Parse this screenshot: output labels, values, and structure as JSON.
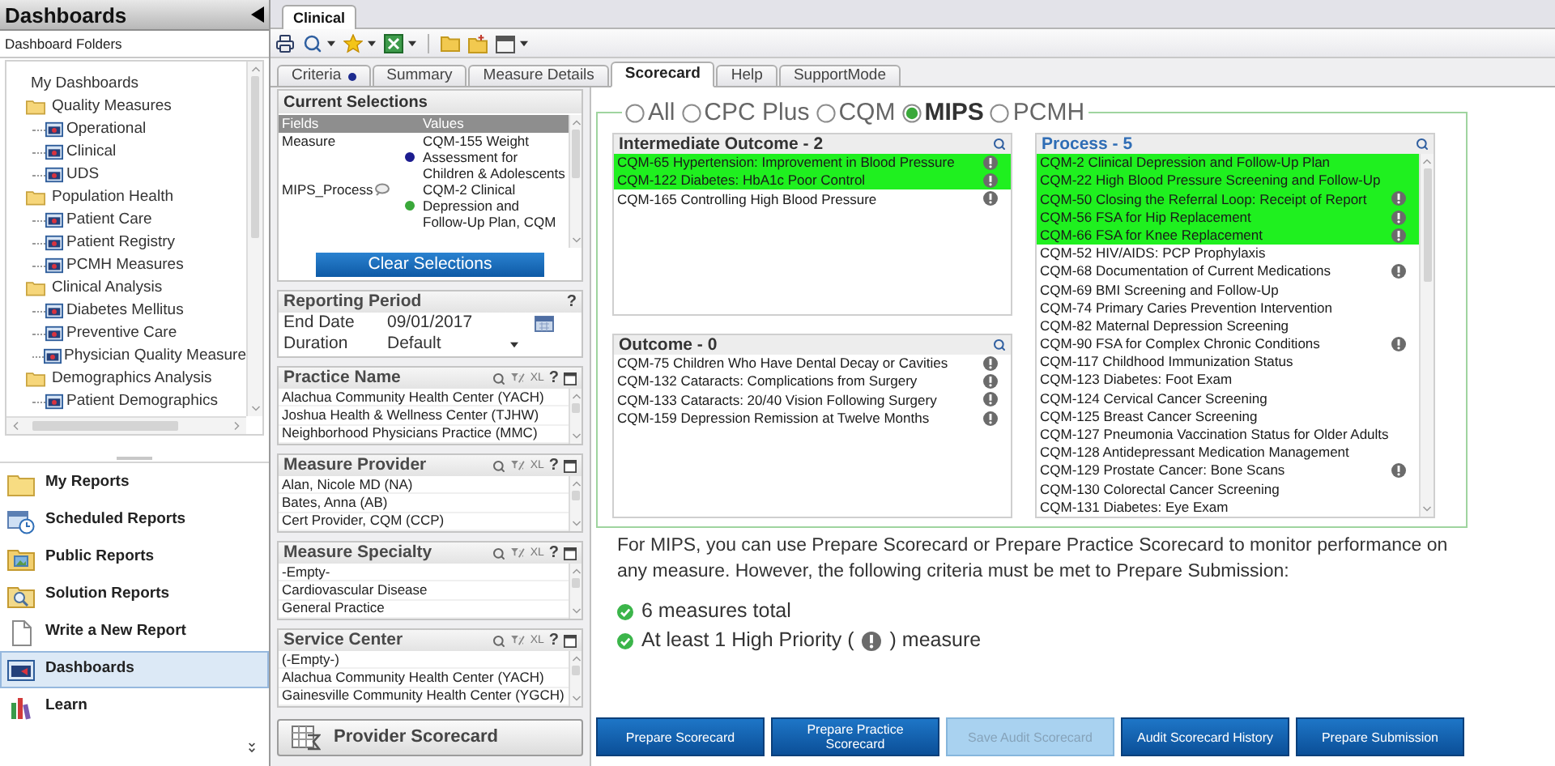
{
  "sidebar": {
    "title": "Dashboards",
    "subtitle": "Dashboard Folders",
    "tree": [
      {
        "label": "My Dashboards",
        "children": [
          {
            "label": "Quality Measures",
            "children": [
              {
                "label": "Operational"
              },
              {
                "label": "Clinical"
              },
              {
                "label": "UDS"
              }
            ]
          },
          {
            "label": "Population Health",
            "children": [
              {
                "label": "Patient Care"
              },
              {
                "label": "Patient Registry"
              },
              {
                "label": "PCMH Measures"
              }
            ]
          },
          {
            "label": "Clinical Analysis",
            "children": [
              {
                "label": "Diabetes Mellitus"
              },
              {
                "label": "Preventive Care"
              },
              {
                "label": "Physician Quality Measure"
              }
            ]
          },
          {
            "label": "Demographics Analysis",
            "children": [
              {
                "label": "Patient Demographics"
              }
            ]
          }
        ]
      }
    ],
    "nav": [
      {
        "label": "My Reports",
        "selected": false
      },
      {
        "label": "Scheduled Reports",
        "selected": false
      },
      {
        "label": "Public Reports",
        "selected": false
      },
      {
        "label": "Solution Reports",
        "selected": false
      },
      {
        "label": "Write a New Report",
        "selected": false
      },
      {
        "label": "Dashboards",
        "selected": true
      },
      {
        "label": "Learn",
        "selected": false
      }
    ]
  },
  "document_tabs": [
    {
      "label": "Clinical",
      "selected": true
    }
  ],
  "view_tabs": [
    {
      "label": "Criteria",
      "selected": false,
      "marked": true
    },
    {
      "label": "Summary",
      "selected": false,
      "marked": false
    },
    {
      "label": "Measure Details",
      "selected": false,
      "marked": false
    },
    {
      "label": "Scorecard",
      "selected": true,
      "marked": false
    },
    {
      "label": "Help",
      "selected": false,
      "marked": false
    },
    {
      "label": "SupportMode",
      "selected": false,
      "marked": false
    }
  ],
  "criteria_panel": {
    "current_selections": {
      "title": "Current Selections",
      "columns": [
        "Fields",
        "Values"
      ],
      "rows": [
        {
          "field": "Measure",
          "has_icon": false,
          "color": "#1c1c8f",
          "value": "CQM-155 Weight Assessment for Children & Adolescents"
        },
        {
          "field": "MIPS_Process",
          "has_icon": true,
          "color": "#3aa83a",
          "value": "CQM-2 Clinical Depression and Follow-Up Plan, CQM"
        }
      ],
      "button": "Clear Selections"
    },
    "reporting_period": {
      "title": "Reporting Period",
      "help": "?",
      "fields": [
        {
          "label": "End Date",
          "value": "09/01/2017",
          "kind": "date"
        },
        {
          "label": "Duration",
          "value": "Default",
          "kind": "select"
        }
      ]
    },
    "filters": [
      {
        "title": "Practice Name",
        "export": "XL",
        "help": "?",
        "items": [
          "Alachua Community Health Center (YACH)",
          "Joshua Health & Wellness Center (TJHW)",
          "Neighborhood Physicians Practice (MMC)"
        ]
      },
      {
        "title": "Measure Provider",
        "export": "XL",
        "help": "?",
        "items": [
          "Alan, Nicole MD (NA)",
          "Bates, Anna (AB)",
          "Cert Provider, CQM (CCP)"
        ]
      },
      {
        "title": "Measure Specialty",
        "export": "XL",
        "help": "?",
        "items": [
          "-Empty-",
          "Cardiovascular Disease",
          "General Practice"
        ]
      },
      {
        "title": "Service Center",
        "export": "XL",
        "help": "?",
        "items": [
          "(-Empty-)",
          "Alachua Community Health Center (YACH)",
          "Gainesville Community Health Center (YGCH)"
        ]
      }
    ],
    "provider_scorecard_button": "Provider Scorecard"
  },
  "scorecard": {
    "programs": [
      {
        "label": "All",
        "selected": false
      },
      {
        "label": "CPC Plus",
        "selected": false
      },
      {
        "label": "CQM",
        "selected": false
      },
      {
        "label": "MIPS",
        "selected": true
      },
      {
        "label": "PCMH",
        "selected": false
      }
    ],
    "panels": [
      {
        "title": "Intermediate Outcome - 2",
        "focused": false,
        "items": [
          {
            "label": "CQM-65 Hypertension: Improvement in Blood Pressure",
            "selected": true,
            "high_priority": true
          },
          {
            "label": "CQM-122 Diabetes: HbA1c Poor Control",
            "selected": true,
            "high_priority": true
          },
          {
            "label": "CQM-165 Controlling High Blood Pressure",
            "selected": false,
            "high_priority": true
          }
        ]
      },
      {
        "title": "Outcome - 0",
        "focused": false,
        "items": [
          {
            "label": "CQM-75 Children Who Have Dental Decay or Cavities",
            "selected": false,
            "high_priority": true
          },
          {
            "label": "CQM-132 Cataracts: Complications from Surgery",
            "selected": false,
            "high_priority": true
          },
          {
            "label": "CQM-133 Cataracts: 20/40 Vision Following Surgery",
            "selected": false,
            "high_priority": true
          },
          {
            "label": "CQM-159 Depression Remission at Twelve Months",
            "selected": false,
            "high_priority": true
          }
        ]
      },
      {
        "title": "Process - 5",
        "focused": true,
        "items": [
          {
            "label": "CQM-2 Clinical Depression and Follow-Up Plan",
            "selected": true,
            "high_priority": false
          },
          {
            "label": "CQM-22 High Blood Pressure Screening and Follow-Up",
            "selected": true,
            "high_priority": false
          },
          {
            "label": "CQM-50 Closing the Referral Loop: Receipt of Report",
            "selected": true,
            "high_priority": true
          },
          {
            "label": "CQM-56 FSA for Hip Replacement",
            "selected": true,
            "high_priority": true
          },
          {
            "label": "CQM-66 FSA for Knee Replacement",
            "selected": true,
            "high_priority": true
          },
          {
            "label": "CQM-52 HIV/AIDS: PCP Prophylaxis",
            "selected": false,
            "high_priority": false
          },
          {
            "label": "CQM-68 Documentation of Current Medications",
            "selected": false,
            "high_priority": true
          },
          {
            "label": "CQM-69 BMI Screening and Follow-Up",
            "selected": false,
            "high_priority": false
          },
          {
            "label": "CQM-74 Primary Caries Prevention Intervention",
            "selected": false,
            "high_priority": false
          },
          {
            "label": "CQM-82 Maternal Depression Screening",
            "selected": false,
            "high_priority": false
          },
          {
            "label": "CQM-90 FSA for Complex Chronic Conditions",
            "selected": false,
            "high_priority": true
          },
          {
            "label": "CQM-117 Childhood Immunization Status",
            "selected": false,
            "high_priority": false
          },
          {
            "label": "CQM-123 Diabetes: Foot Exam",
            "selected": false,
            "high_priority": false
          },
          {
            "label": "CQM-124 Cervical Cancer Screening",
            "selected": false,
            "high_priority": false
          },
          {
            "label": "CQM-125 Breast Cancer Screening",
            "selected": false,
            "high_priority": false
          },
          {
            "label": "CQM-127 Pneumonia Vaccination Status for Older Adults",
            "selected": false,
            "high_priority": false
          },
          {
            "label": "CQM-128 Antidepressant Medication Management",
            "selected": false,
            "high_priority": false
          },
          {
            "label": "CQM-129 Prostate Cancer: Bone Scans",
            "selected": false,
            "high_priority": true
          },
          {
            "label": "CQM-130 Colorectal Cancer Screening",
            "selected": false,
            "high_priority": false
          },
          {
            "label": "CQM-131 Diabetes: Eye Exam",
            "selected": false,
            "high_priority": false
          }
        ]
      }
    ],
    "note": "For MIPS, you can use Prepare Scorecard or Prepare Practice Scorecard to monitor performance on any measure. However, the following criteria must be met to Prepare Submission:",
    "requirements": [
      {
        "met": true,
        "text": "6 measures total"
      },
      {
        "met": true,
        "text": "At least 1 High Priority (",
        "text_after": ") measure"
      }
    ],
    "buttons": [
      {
        "label": "Prepare Scorecard",
        "disabled": false
      },
      {
        "label": "Prepare Practice Scorecard",
        "disabled": false
      },
      {
        "label": "Save Audit Scorecard",
        "disabled": true
      },
      {
        "label": "Audit Scorecard History",
        "disabled": false
      },
      {
        "label": "Prepare Submission",
        "disabled": false
      }
    ]
  }
}
